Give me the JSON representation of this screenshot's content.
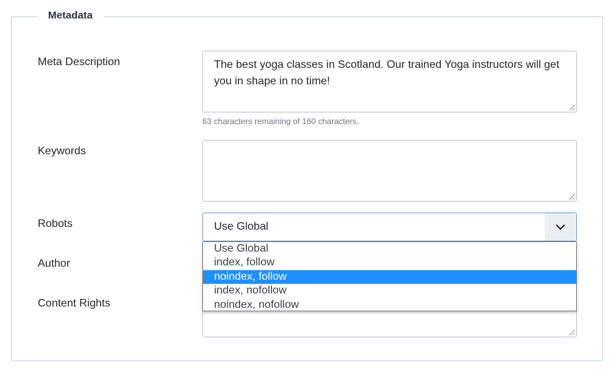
{
  "fieldset": {
    "legend": "Metadata"
  },
  "meta_description": {
    "label": "Meta Description",
    "value": "The best yoga classes in Scotland. Our trained Yoga instructors will get you in shape in no time!",
    "char_count": "63 characters remaining of 160 characters."
  },
  "keywords": {
    "label": "Keywords",
    "value": ""
  },
  "robots": {
    "label": "Robots",
    "selected": "Use Global",
    "options": [
      {
        "label": "Use Global",
        "highlighted": false
      },
      {
        "label": "index, follow",
        "highlighted": false
      },
      {
        "label": "noindex, follow",
        "highlighted": true
      },
      {
        "label": "index, nofollow",
        "highlighted": false
      },
      {
        "label": "noindex, nofollow",
        "highlighted": false
      }
    ]
  },
  "author": {
    "label": "Author"
  },
  "content_rights": {
    "label": "Content Rights"
  },
  "colors": {
    "highlight": "#1e90ff",
    "border": "#c3d2e1"
  },
  "icons": {
    "select_arrow": "chevron-down-icon",
    "resize": "resize-grip-icon"
  }
}
